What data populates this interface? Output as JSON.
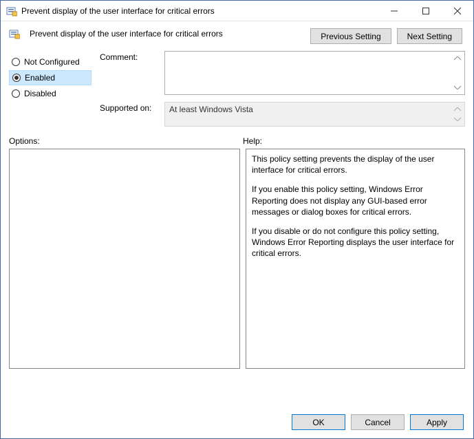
{
  "window": {
    "title": "Prevent display of the user interface for critical errors"
  },
  "header": {
    "policy_title": "Prevent display of the user interface for critical errors",
    "previous": "Previous Setting",
    "next": "Next Setting"
  },
  "radios": {
    "not_configured": "Not Configured",
    "enabled": "Enabled",
    "disabled": "Disabled",
    "selected": "enabled"
  },
  "fields": {
    "comment_label": "Comment:",
    "comment_value": "",
    "supported_label": "Supported on:",
    "supported_value": "At least Windows Vista"
  },
  "lower_labels": {
    "options": "Options:",
    "help": "Help:"
  },
  "help": {
    "p1": "This policy setting prevents the display of the user interface for critical errors.",
    "p2": "If you enable this policy setting, Windows Error Reporting does not display any GUI-based error messages or dialog boxes for critical errors.",
    "p3": "If you disable or do not configure this policy setting, Windows Error Reporting displays the user interface for critical errors."
  },
  "footer": {
    "ok": "OK",
    "cancel": "Cancel",
    "apply": "Apply"
  }
}
